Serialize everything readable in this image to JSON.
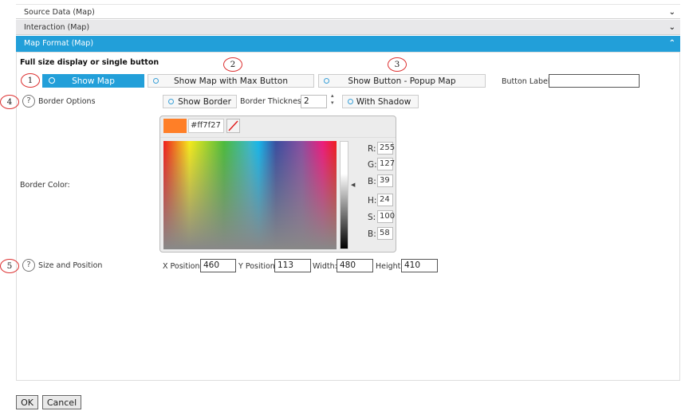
{
  "sections": [
    {
      "label": "Source Data (Map)",
      "expanded": false
    },
    {
      "label": "Interaction (Map)",
      "expanded": false
    },
    {
      "label": "Map Format (Map)",
      "expanded": true
    }
  ],
  "accent": "#229fd9",
  "display_mode": {
    "heading": "Full size display or single button",
    "options": [
      "Show Map",
      "Show Map with Max Button",
      "Show Button - Popup Map"
    ],
    "selected": "Show Map",
    "button_label_label": "Button Label",
    "button_label_value": ""
  },
  "annotations": [
    "1",
    "2",
    "3",
    "4",
    "5"
  ],
  "border": {
    "label": "Border Options",
    "show_border": "Show Border",
    "thickness_label": "Border Thickness:",
    "thickness": "2",
    "with_shadow": "With Shadow",
    "color_label": "Border Color:",
    "color": {
      "hex": "#ff7f27",
      "R": "255",
      "G": "127",
      "B": "39",
      "H": "24",
      "S": "100",
      "Bv": "58"
    }
  },
  "size": {
    "label": "Size and Position",
    "x_label": "X Position:",
    "x": "460",
    "y_label": "Y Position:",
    "y": "113",
    "w_label": "Width:",
    "w": "480",
    "h_label": "Height:",
    "h": "410"
  },
  "footer": {
    "ok": "OK",
    "cancel": "Cancel"
  }
}
